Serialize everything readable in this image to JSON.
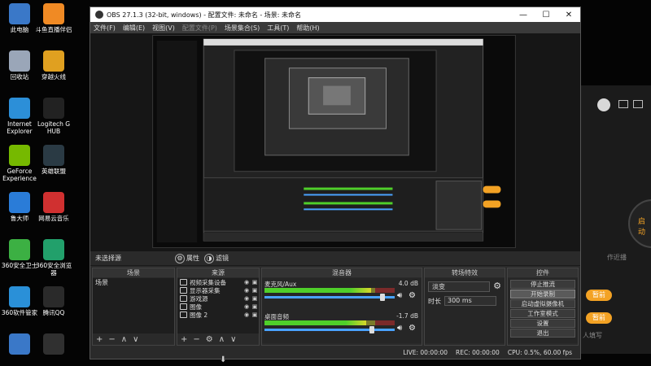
{
  "desktop_icons": [
    {
      "label": "此电脑",
      "icon": "computer-icon",
      "color": "#3a78c8"
    },
    {
      "label": "斗鱼直播伴侣",
      "icon": "douyu-icon",
      "color": "#f08a24"
    },
    {
      "label": "回收站",
      "icon": "recycle-bin-icon",
      "color": "#9aa6b8"
    },
    {
      "label": "穿越火线",
      "icon": "crossfire-icon",
      "color": "#e0a020"
    },
    {
      "label": "Internet\nExplorer",
      "icon": "ie-icon",
      "color": "#2c8fd8"
    },
    {
      "label": "Logitech G\nHUB",
      "icon": "logitech-icon",
      "color": "#222222"
    },
    {
      "label": "GeForce\nExperience",
      "icon": "geforce-icon",
      "color": "#76b900"
    },
    {
      "label": "英雄联盟",
      "icon": "lol-icon",
      "color": "#2a3a44"
    },
    {
      "label": "鲁大师",
      "icon": "ludashi-icon",
      "color": "#2a7cd8"
    },
    {
      "label": "网易云音乐",
      "icon": "netease-music-icon",
      "color": "#d03030"
    },
    {
      "label": "360安全卫士",
      "icon": "360-safe-icon",
      "color": "#3cb043"
    },
    {
      "label": "360安全浏览器",
      "icon": "360-browser-icon",
      "color": "#22a06b"
    },
    {
      "label": "360软件管家",
      "icon": "360-soft-icon",
      "color": "#2a90d8"
    },
    {
      "label": "腾讯QQ",
      "icon": "qq-icon",
      "color": "#2a2a2a"
    },
    {
      "label": "",
      "icon": "folder-icon",
      "color": "#3a78c8"
    },
    {
      "label": "",
      "icon": "obs-icon",
      "color": "#303030"
    }
  ],
  "obs": {
    "title": "OBS 27.1.3 (32-bit, windows) - 配置文件: 未命名 - 场景: 未命名",
    "menu": [
      "文件(F)",
      "编辑(E)",
      "视图(V)",
      "配置文件(P)",
      "场景集合(S)",
      "工具(T)",
      "帮助(H)"
    ],
    "window_controls": [
      "—",
      "☐",
      "✕"
    ],
    "source_bar": {
      "selected": "未选择源",
      "props_label": "属性",
      "filters_label": "滤镜"
    },
    "scenes": {
      "title": "场景",
      "items": [
        "场景"
      ],
      "footer": [
        "+",
        "−",
        "∧",
        "∨"
      ]
    },
    "sources": {
      "title": "来源",
      "items": [
        {
          "name": "视频采集设备",
          "icon": "camera-icon"
        },
        {
          "name": "显示器采集",
          "icon": "monitor-icon"
        },
        {
          "name": "游戏源",
          "icon": "gamepad-icon"
        },
        {
          "name": "图像",
          "icon": "image-icon"
        },
        {
          "name": "图像 2",
          "icon": "image-icon"
        }
      ],
      "footer": [
        "+",
        "−",
        "⚙",
        "∧",
        "∨"
      ]
    },
    "mixer": {
      "title": "混音器",
      "channels": [
        {
          "name": "麦克风/Aux",
          "db": "4.0 dB",
          "level": 0.82,
          "volume": 0.92
        },
        {
          "name": "桌面音频",
          "db": "-1.7 dB",
          "level": 0.78,
          "volume": 0.84
        }
      ]
    },
    "transitions": {
      "title": "转场特效",
      "type": "淡变",
      "duration_label": "时长",
      "duration": "300 ms"
    },
    "controls": {
      "title": "控件",
      "buttons": [
        "停止推流",
        "开始录制",
        "启动虚拟摄像机",
        "工作室模式",
        "设置",
        "退出"
      ],
      "hovered": 1
    },
    "status": {
      "live": "LIVE: 00:00:00",
      "rec": "REC: 00:00:00",
      "cpu": "CPU: 0.5%, 60.00 fps"
    }
  },
  "right_app": {
    "pill1": "暂前",
    "pill2": "暂前",
    "label_a": "作近播",
    "label_b": "人填写",
    "label_c": "启动"
  }
}
